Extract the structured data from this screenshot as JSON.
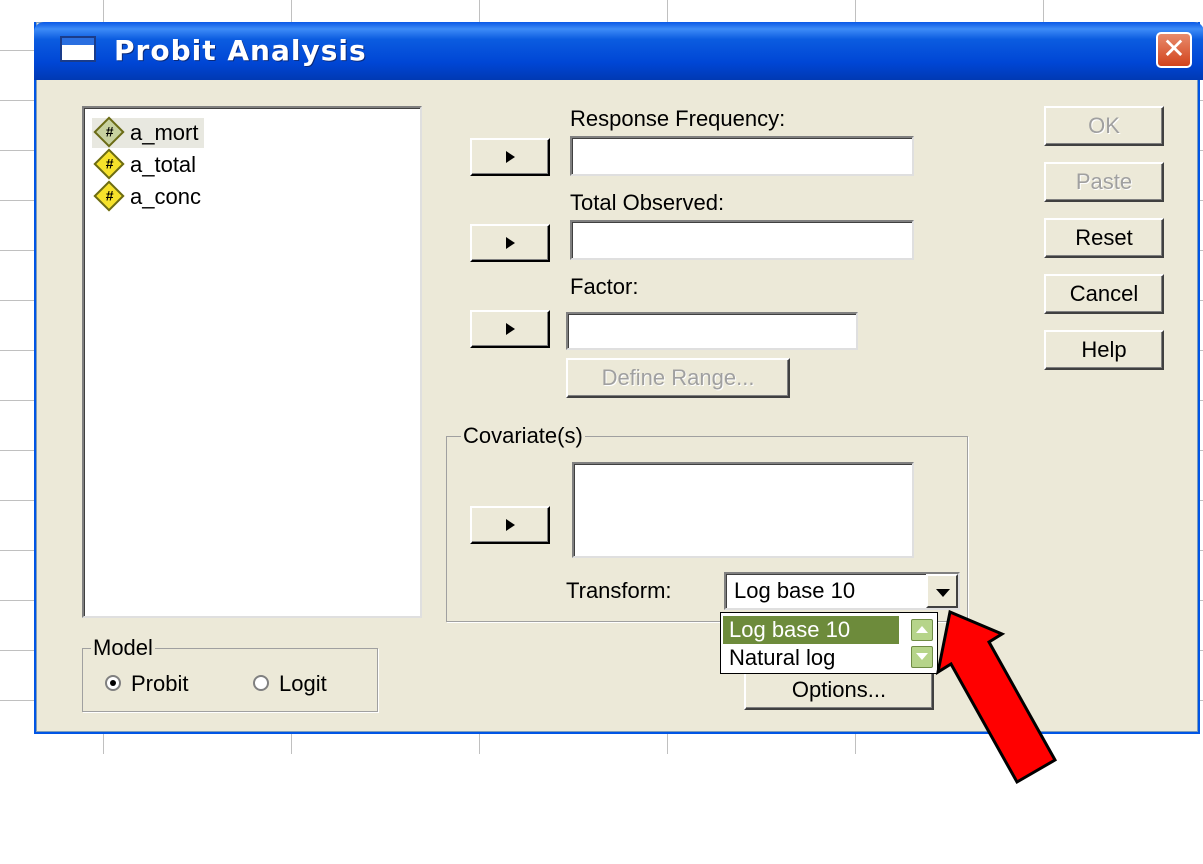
{
  "window": {
    "title": "Probit Analysis",
    "close_glyph": "✕"
  },
  "variables": [
    {
      "name": "a_mort",
      "icon": "numeric-scale-variable-icon",
      "selected": true
    },
    {
      "name": "a_total",
      "icon": "numeric-scale-variable-icon",
      "selected": false
    },
    {
      "name": "a_conc",
      "icon": "numeric-scale-variable-icon",
      "selected": false
    }
  ],
  "variable_icon_glyph": "#",
  "fields": {
    "response_frequency_label": "Response Frequency:",
    "response_frequency_value": "",
    "total_observed_label": "Total Observed:",
    "total_observed_value": "",
    "factor_label": "Factor:",
    "factor_value": "",
    "define_range_label": "Define Range...",
    "covariates_legend": "Covariate(s)",
    "transform_label": "Transform:",
    "transform_selected": "Log base 10"
  },
  "transform_options": [
    "Log base 10",
    "Natural log"
  ],
  "model": {
    "legend": "Model",
    "options": [
      {
        "label": "Probit",
        "checked": true
      },
      {
        "label": "Logit",
        "checked": false
      }
    ]
  },
  "buttons": {
    "ok": "OK",
    "paste": "Paste",
    "reset": "Reset",
    "cancel": "Cancel",
    "help": "Help",
    "options": "Options..."
  },
  "colors": {
    "title_bar": "#0055e5",
    "dialog_bg": "#ece9d8",
    "dropdown_highlight": "#6d8b3b",
    "annotation_arrow": "#ff0000"
  }
}
